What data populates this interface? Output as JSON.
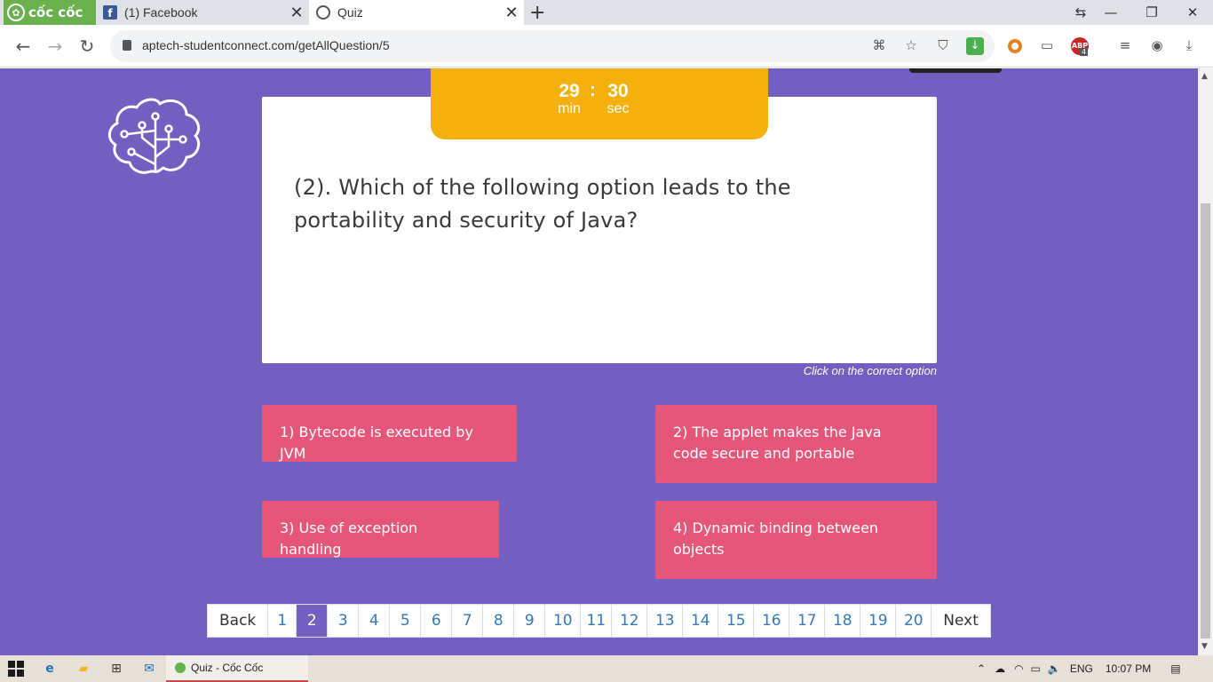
{
  "browser": {
    "brand_label": "cốc cốc",
    "tabs": [
      {
        "title": "(1) Facebook"
      },
      {
        "title": "Quiz"
      }
    ],
    "url": "aptech-studentconnect.com/getAllQuestion/5",
    "extension_badge": "4"
  },
  "timer": {
    "minutes": "29",
    "separator": ":",
    "seconds": "30",
    "minutes_label": "min",
    "seconds_label": "sec"
  },
  "question": {
    "text": "(2).  Which of the following option leads to the portability and security of Java?"
  },
  "hint": "Click on the correct option",
  "options": [
    {
      "label": "1) Bytecode is executed by JVM"
    },
    {
      "label": "2) The applet makes the Java code secure and portable"
    },
    {
      "label": "3) Use of exception handling"
    },
    {
      "label": "4) Dynamic binding between objects"
    }
  ],
  "pagination": {
    "back": "Back",
    "next": "Next",
    "pages": [
      "1",
      "2",
      "3",
      "4",
      "5",
      "6",
      "7",
      "8",
      "9",
      "10",
      "11",
      "12",
      "13",
      "14",
      "15",
      "16",
      "17",
      "18",
      "19",
      "20"
    ],
    "active_page": "2"
  },
  "colors": {
    "page_bg": "#735fbf",
    "timer_bg": "#f4b10e",
    "option_bg": "#e5567a",
    "link_blue": "#337ab7"
  },
  "taskbar": {
    "active_window": "Quiz - Cốc Cốc",
    "language": "ENG",
    "clock": "10:07 PM"
  }
}
